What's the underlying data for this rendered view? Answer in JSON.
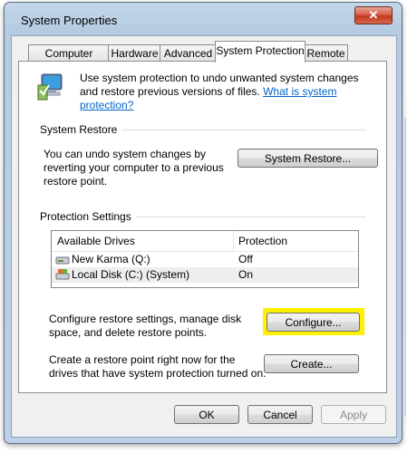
{
  "window": {
    "title": "System Properties",
    "close_glyph": "✕"
  },
  "tabs": [
    {
      "label": "Computer Name"
    },
    {
      "label": "Hardware"
    },
    {
      "label": "Advanced"
    },
    {
      "label": "System Protection",
      "active": true
    },
    {
      "label": "Remote"
    }
  ],
  "intro": {
    "text": "Use system protection to undo unwanted system changes and restore previous versions of files.",
    "link": "What is system protection?"
  },
  "system_restore": {
    "title": "System Restore",
    "description": "You can undo system changes by reverting your computer to a previous restore point.",
    "button": "System Restore..."
  },
  "protection": {
    "title": "Protection Settings",
    "columns": [
      "Available Drives",
      "Protection"
    ],
    "drives": [
      {
        "name": "New Karma (Q:)",
        "protection": "Off",
        "icon": "removable-drive-icon"
      },
      {
        "name": "Local Disk (C:) (System)",
        "protection": "On",
        "icon": "system-drive-icon"
      }
    ],
    "configure_text": "Configure restore settings, manage disk space, and delete restore points.",
    "configure_button": "Configure...",
    "create_text": "Create a restore point right now for the drives that have system protection turned on.",
    "create_button": "Create..."
  },
  "footer": {
    "ok": "OK",
    "cancel": "Cancel",
    "apply": "Apply"
  },
  "colors": {
    "highlight": "#fff200",
    "link": "#0066cc"
  }
}
